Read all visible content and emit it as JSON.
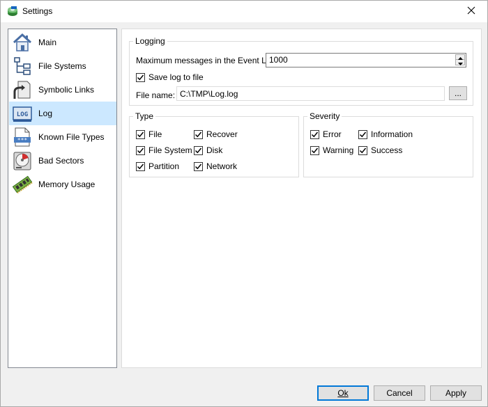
{
  "window": {
    "title": "Settings",
    "icon": "app-disk-icon"
  },
  "sidebar": {
    "items": [
      {
        "label": "Main",
        "icon": "home-icon",
        "selected": false
      },
      {
        "label": "File Systems",
        "icon": "tree-icon",
        "selected": false
      },
      {
        "label": "Symbolic Links",
        "icon": "link-icon",
        "selected": false
      },
      {
        "label": "Log",
        "icon": "log-icon",
        "selected": true
      },
      {
        "label": "Known File Types",
        "icon": "file-types-icon",
        "selected": false
      },
      {
        "label": "Bad Sectors",
        "icon": "disk-icon",
        "selected": false
      },
      {
        "label": "Memory Usage",
        "icon": "memory-icon",
        "selected": false
      }
    ]
  },
  "logging": {
    "title": "Logging",
    "max_messages_label": "Maximum messages in the Event Log:",
    "max_messages_value": "1000",
    "save_log_label": "Save log to file",
    "save_log_checked": true,
    "file_name_label": "File name:",
    "file_name_value": "C:\\TMP\\Log.log",
    "browse_label": "..."
  },
  "type": {
    "title": "Type",
    "items": [
      {
        "label": "File",
        "checked": true
      },
      {
        "label": "File System",
        "checked": true
      },
      {
        "label": "Partition",
        "checked": true
      },
      {
        "label": "Recover",
        "checked": true
      },
      {
        "label": "Disk",
        "checked": true
      },
      {
        "label": "Network",
        "checked": true
      }
    ]
  },
  "severity": {
    "title": "Severity",
    "items": [
      {
        "label": "Error",
        "checked": true
      },
      {
        "label": "Warning",
        "checked": true
      },
      {
        "label": "Information",
        "checked": true
      },
      {
        "label": "Success",
        "checked": true
      }
    ]
  },
  "buttons": {
    "ok_label": "Ok",
    "cancel_label": "Cancel",
    "apply_label": "Apply"
  },
  "colors": {
    "selection": "#cce8ff",
    "accent": "#0078d7"
  }
}
